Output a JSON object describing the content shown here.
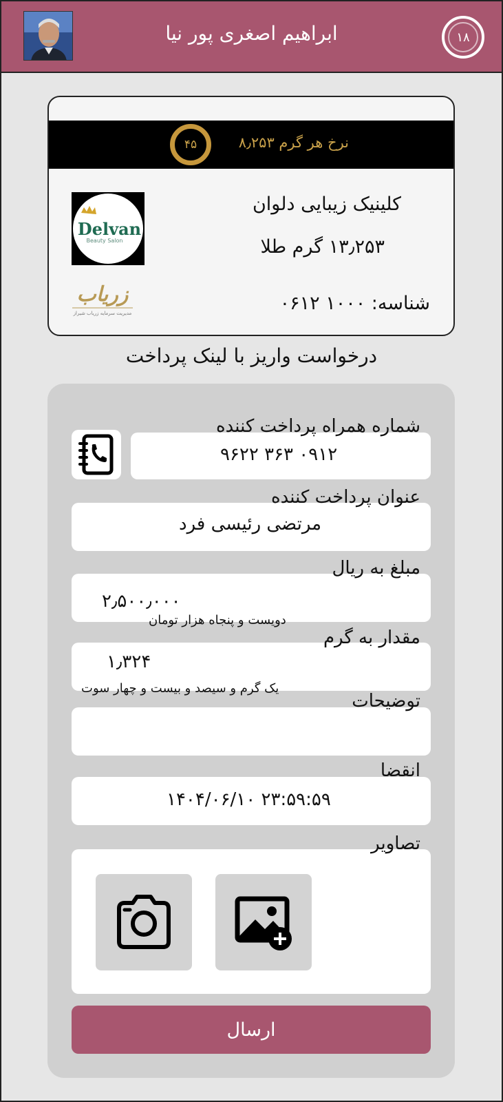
{
  "header": {
    "user_name": "ابراهیم اصغری پور نیا",
    "timer": "۱۸"
  },
  "card": {
    "rate_label": "نرخ هر گرم  ۸٫۲۵۳",
    "badge": "۴۵",
    "clinic_name": "کلینیک زیبایی دلوان",
    "gold_amount": "۱۳٫۲۵۳ گرم طلا",
    "id_line": "شناسه: ۱۰۰۰ ۰۶۱۲",
    "delvan_logo_text": "Delvan",
    "delvan_logo_sub": "Beauty Salon",
    "zaryab_logo_text": "زریاب",
    "zaryab_logo_sub": "مدیریت سرمایه زریاب شیراز"
  },
  "section_title": "درخواست واریز با لینک پرداخت",
  "form": {
    "phone": {
      "label": "شماره همراه پرداخت کننده",
      "value": "۰۹۱۲ ۳۶۳ ۹۶۲۲"
    },
    "payer": {
      "label": "عنوان پرداخت کننده",
      "value": "مرتضی رئیسی فرد"
    },
    "amount": {
      "label": "مبلغ به ریال",
      "value": "۲٫۵۰۰٫۰۰۰",
      "words": "دویست و پنجاه هزار تومان"
    },
    "grams": {
      "label": "مقدار به گرم",
      "value": "۱٫۳۲۴",
      "words": "یک گرم و سیصد و بیست و چهار سوت"
    },
    "notes": {
      "label": "توضیحات",
      "value": ""
    },
    "expiry": {
      "label": "انقضا",
      "value": "۲۳:۵۹:۵۹  ۱۴۰۴/۰۶/۱۰"
    },
    "images": {
      "label": "تصاویر"
    },
    "submit_label": "ارسال"
  },
  "colors": {
    "accent": "#a8566f",
    "gold": "#c6973c",
    "background": "#e6e6e6",
    "panel": "#d0d0d0"
  },
  "icons": [
    "contacts-book-icon",
    "camera-icon",
    "add-image-icon"
  ]
}
